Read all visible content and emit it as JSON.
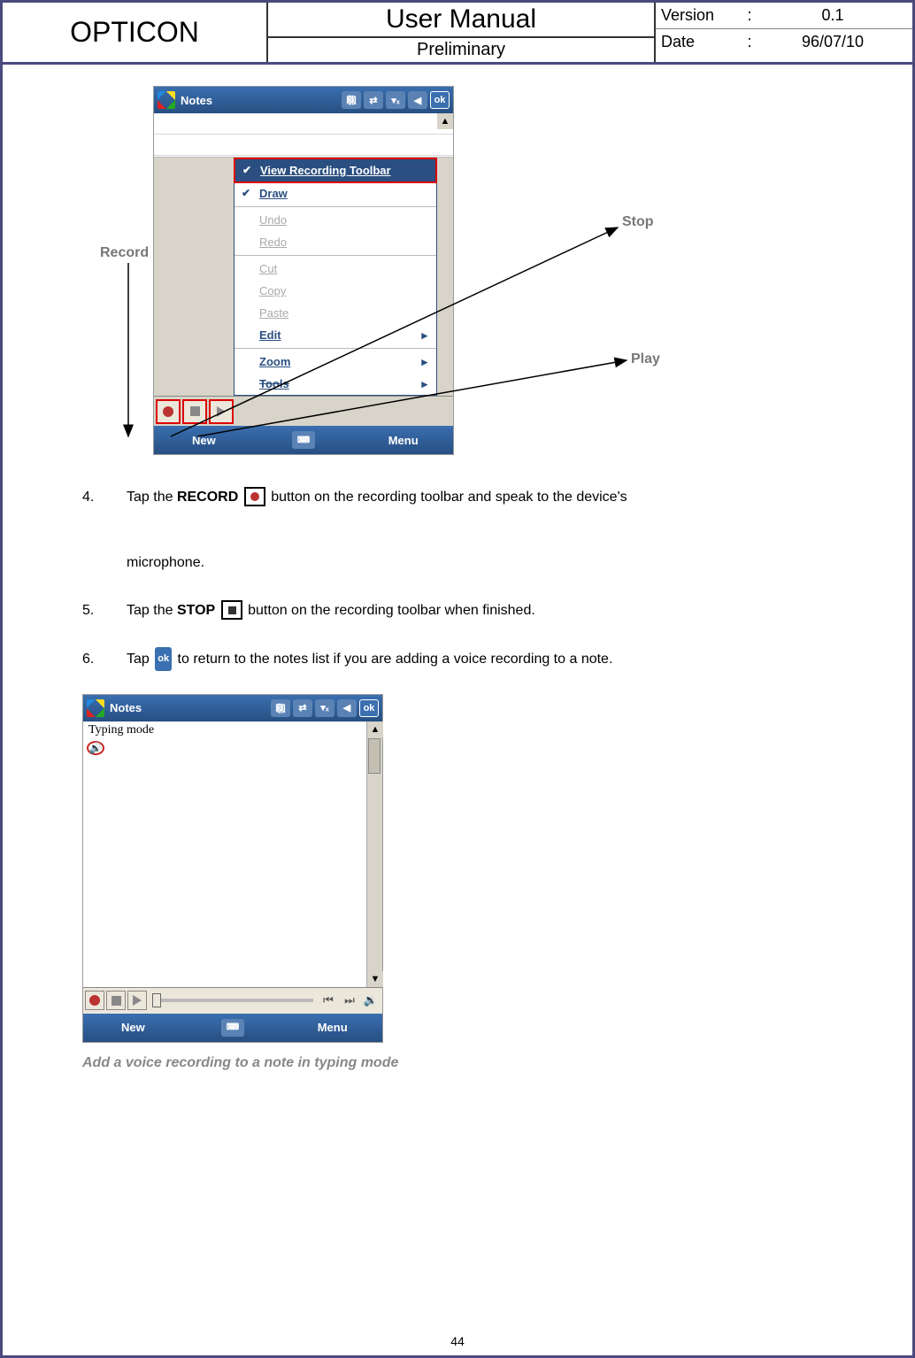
{
  "header": {
    "brand": "OPTICON",
    "title": "User Manual",
    "subtitle": "Preliminary",
    "version_label": "Version",
    "version_value": "0.1",
    "date_label": "Date",
    "date_value": "96/07/10"
  },
  "screenshot1": {
    "app_title": "Notes",
    "ok": "ok",
    "menu": {
      "view_recording_toolbar": "View Recording Toolbar",
      "draw": "Draw",
      "undo": "Undo",
      "redo": "Redo",
      "cut": "Cut",
      "copy": "Copy",
      "paste": "Paste",
      "edit": "Edit",
      "zoom": "Zoom",
      "tools": "Tools"
    },
    "bottombar": {
      "new": "New",
      "menu": "Menu"
    },
    "callouts": {
      "record": "Record",
      "stop": "Stop",
      "play": "Play"
    }
  },
  "steps": {
    "s4_num": "4.",
    "s4_a": "Tap the ",
    "s4_b": "RECORD",
    "s4_c": " button on the recording toolbar and speak to the device's",
    "s4_d": "microphone.",
    "s5_num": "5.",
    "s5_a": "Tap the ",
    "s5_b": "STOP",
    "s5_c": " button on the recording toolbar when finished.",
    "s6_num": "6.",
    "s6_a": "Tap ",
    "s6_ok": "ok",
    "s6_b": " to return to the notes list if you are adding a voice recording to a note."
  },
  "screenshot2": {
    "app_title": "Notes",
    "ok": "ok",
    "typing_mode": "Typing mode",
    "bottombar": {
      "new": "New",
      "menu": "Menu"
    }
  },
  "caption": "Add a voice recording to a note in typing mode",
  "page_number": "44"
}
